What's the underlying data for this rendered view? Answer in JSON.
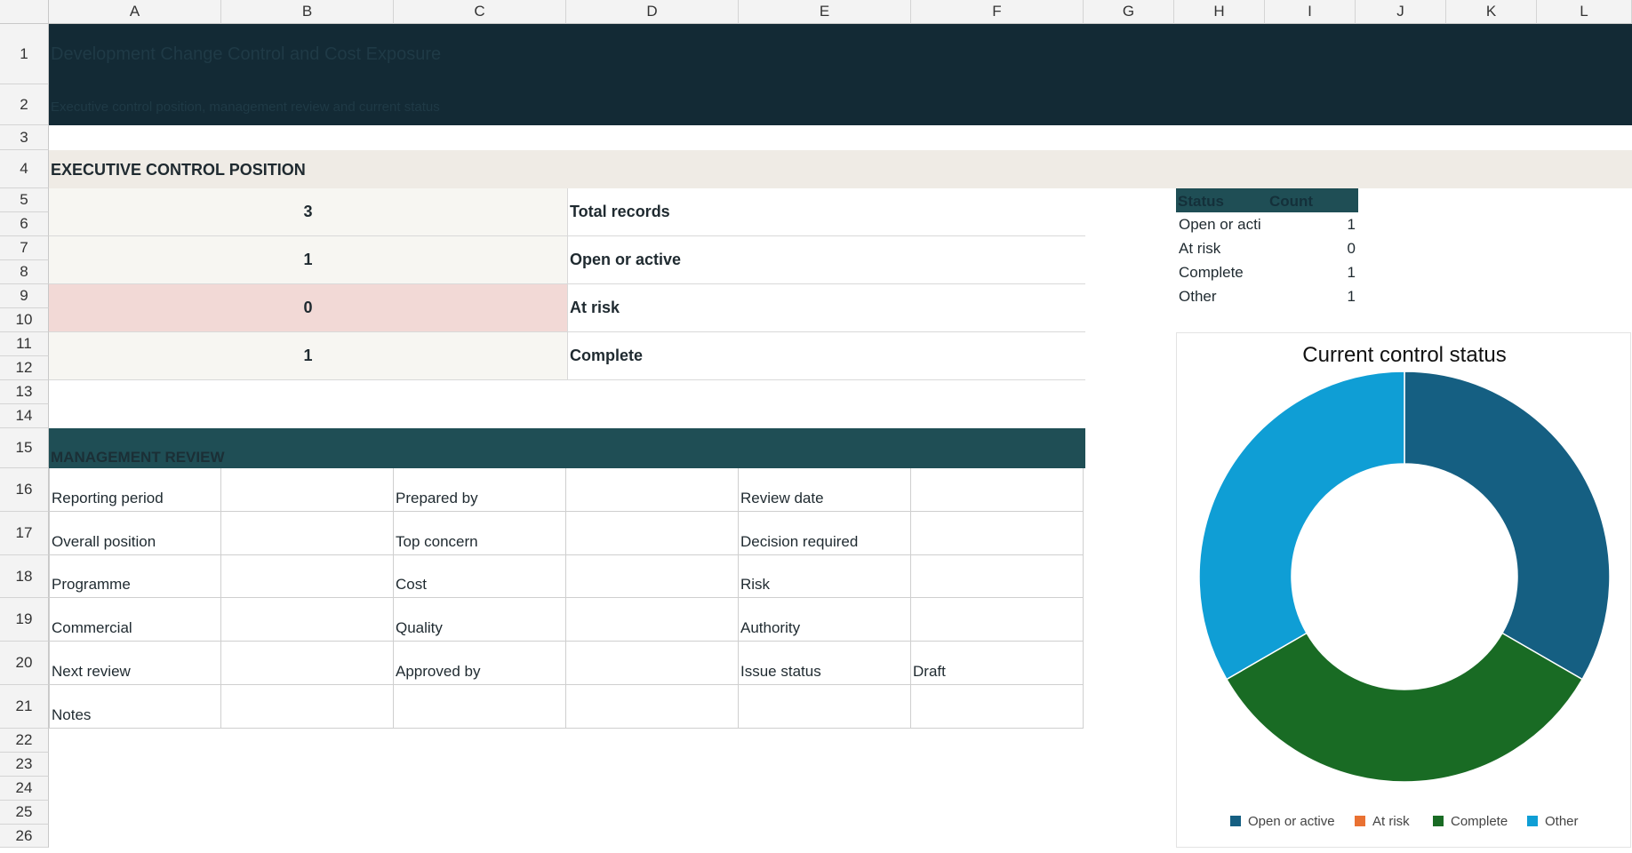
{
  "columns": [
    "A",
    "B",
    "C",
    "D",
    "E",
    "F",
    "G",
    "H",
    "I",
    "J",
    "K",
    "L"
  ],
  "rows": [
    "1",
    "2",
    "3",
    "4",
    "5",
    "6",
    "7",
    "8",
    "9",
    "10",
    "11",
    "12",
    "13",
    "14",
    "15",
    "16",
    "17",
    "18",
    "19",
    "20",
    "21",
    "22",
    "23",
    "24",
    "25",
    "26"
  ],
  "title": "Development Change Control and Cost Exposure",
  "subtitle": "Executive control position, management review and current status",
  "section": "EXECUTIVE CONTROL POSITION",
  "kpis": [
    {
      "value": "3",
      "label": "Total records"
    },
    {
      "value": "1",
      "label": "Open or active"
    },
    {
      "value": "0",
      "label": "At risk"
    },
    {
      "value": "1",
      "label": "Complete"
    }
  ],
  "management_review": {
    "heading": "MANAGEMENT REVIEW",
    "rows": [
      [
        "Reporting period",
        "",
        "Prepared by",
        "",
        "Review date",
        ""
      ],
      [
        "Overall position",
        "",
        "Top concern",
        "",
        "Decision required",
        ""
      ],
      [
        "Programme",
        "",
        "Cost",
        "",
        "Risk",
        ""
      ],
      [
        "Commercial",
        "",
        "Quality",
        "",
        "Authority",
        ""
      ],
      [
        "Next review",
        "",
        "Approved by",
        "",
        "Issue status",
        "Draft"
      ],
      [
        "Notes",
        "",
        "",
        "",
        "",
        ""
      ]
    ]
  },
  "status_table": {
    "headers": [
      "Status",
      "Count"
    ],
    "rows": [
      {
        "status": "Open or acti",
        "count": "1"
      },
      {
        "status": "At risk",
        "count": "0"
      },
      {
        "status": "Complete",
        "count": "1"
      },
      {
        "status": "Other",
        "count": "1"
      }
    ]
  },
  "chart_data": {
    "type": "pie",
    "title": "Current control status",
    "categories": [
      "Open or active",
      "At risk",
      "Complete",
      "Other"
    ],
    "values": [
      1,
      0,
      1,
      1
    ],
    "colors": [
      "#155f82",
      "#e97132",
      "#196b24",
      "#0f9ed5"
    ],
    "donut": true,
    "legend": "bottom"
  }
}
